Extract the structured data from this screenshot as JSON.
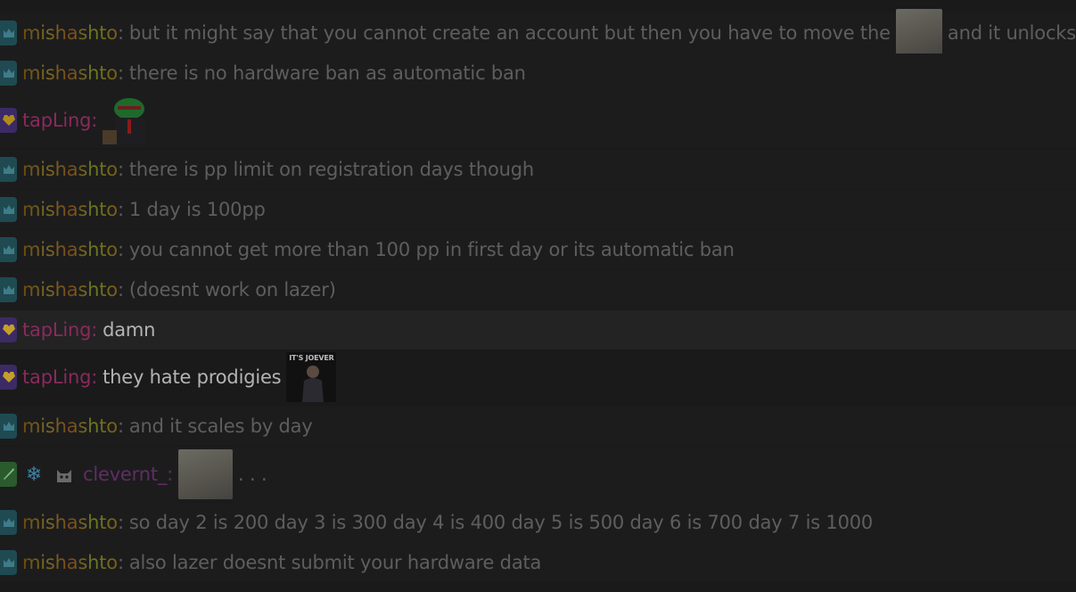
{
  "messages": [
    {
      "user": "mishashto",
      "text_before": "but it might say that you cannot create an account but then you have to move the",
      "text_after": "and it unlocks"
    },
    {
      "user": "mishashto",
      "text": "there is no hardware ban as automatic ban"
    },
    {
      "user": "tapLing",
      "text": ""
    },
    {
      "user": "mishashto",
      "text": "there is pp limit on registration days though"
    },
    {
      "user": "mishashto",
      "text": "1 day is 100pp"
    },
    {
      "user": "mishashto",
      "text": "you cannot get more than 100 pp in first day or its automatic ban"
    },
    {
      "user": "mishashto",
      "text": "(doesnt work on lazer)"
    },
    {
      "user": "tapLing",
      "text": "damn"
    },
    {
      "user": "tapLing",
      "text": "they hate prodigies"
    },
    {
      "user": "mishashto",
      "text": "and it scales by day"
    },
    {
      "user": "clevernt_",
      "text": ". . ."
    },
    {
      "user": "mishashto",
      "text": "so day 2 is 200 day 3 is 300 day 4 is 400 day 5 is 500 day 6 is 700 day 7 is 1000"
    },
    {
      "user": "mishashto",
      "text": "also lazer doesnt submit your hardware data"
    }
  ],
  "emotes": {
    "joever_caption": "IT'S JOEVER",
    "snowflake": "❄"
  },
  "colors": {
    "mishashto_gradient": [
      "#6b4a10",
      "#7a6a22",
      "#7a4a1a"
    ],
    "tapLing": "#8a2a5c",
    "clevernt_": "#5f2e63",
    "dim_text": "#5e5e60",
    "bright_text": "#b4b4b6",
    "mod_badge": "#1f4a52"
  },
  "icons": {
    "mod": "crown-icon",
    "sub": "heart-gem-icon",
    "clevernt_badge": "sword-icon"
  }
}
